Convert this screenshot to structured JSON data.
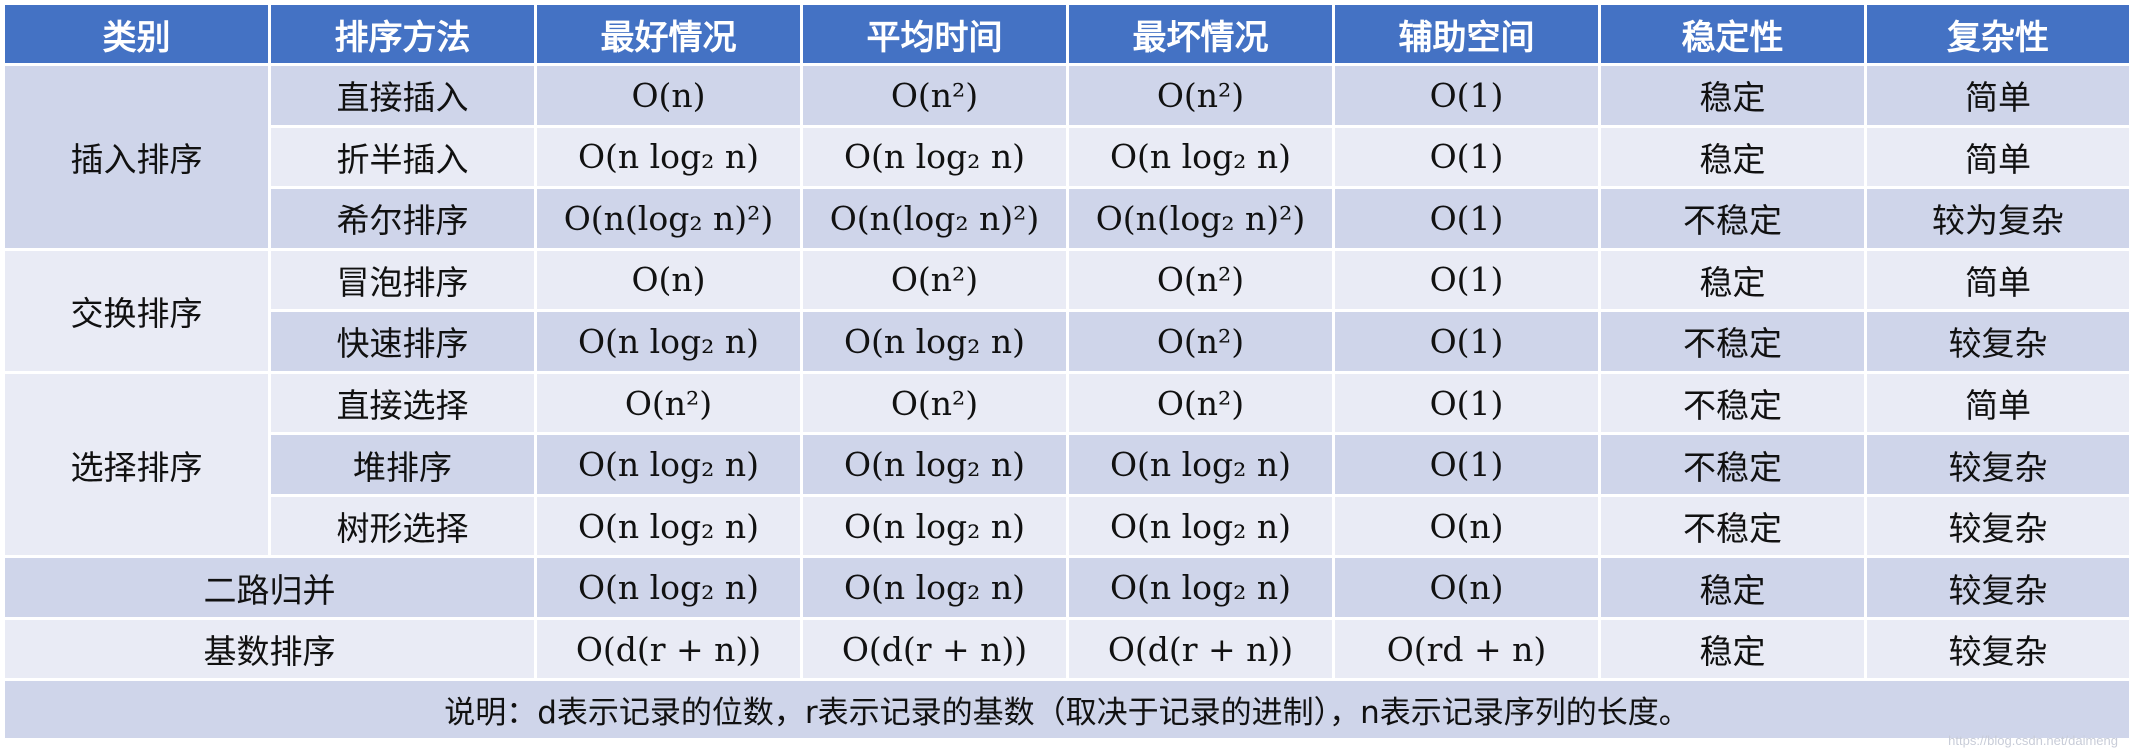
{
  "headers": [
    "类别",
    "排序方法",
    "最好情况",
    "平均时间",
    "最坏情况",
    "辅助空间",
    "稳定性",
    "复杂性"
  ],
  "groups": [
    {
      "category": "插入排序",
      "rows": [
        {
          "method": "直接插入",
          "best": "O(n)",
          "avg": "O(n²)",
          "worst": "O(n²)",
          "space": "O(1)",
          "stability": "稳定",
          "complexity": "简单"
        },
        {
          "method": "折半插入",
          "best": "O(n log₂ n)",
          "avg": "O(n log₂ n)",
          "worst": "O(n log₂ n)",
          "space": "O(1)",
          "stability": "稳定",
          "complexity": "简单"
        },
        {
          "method": "希尔排序",
          "best": "O(n(log₂ n)²)",
          "avg": "O(n(log₂ n)²)",
          "worst": "O(n(log₂ n)²)",
          "space": "O(1)",
          "stability": "不稳定",
          "complexity": "较为复杂"
        }
      ]
    },
    {
      "category": "交换排序",
      "rows": [
        {
          "method": "冒泡排序",
          "best": "O(n)",
          "avg": "O(n²)",
          "worst": "O(n²)",
          "space": "O(1)",
          "stability": "稳定",
          "complexity": "简单"
        },
        {
          "method": "快速排序",
          "best": "O(n log₂ n)",
          "avg": "O(n log₂ n)",
          "worst": "O(n²)",
          "space": "O(1)",
          "stability": "不稳定",
          "complexity": "较复杂"
        }
      ]
    },
    {
      "category": "选择排序",
      "rows": [
        {
          "method": "直接选择",
          "best": "O(n²)",
          "avg": "O(n²)",
          "worst": "O(n²)",
          "space": "O(1)",
          "stability": "不稳定",
          "complexity": "简单"
        },
        {
          "method": "堆排序",
          "best": "O(n log₂ n)",
          "avg": "O(n log₂ n)",
          "worst": "O(n log₂ n)",
          "space": "O(1)",
          "stability": "不稳定",
          "complexity": "较复杂"
        },
        {
          "method": "树形选择",
          "best": "O(n log₂ n)",
          "avg": "O(n log₂ n)",
          "worst": "O(n log₂ n)",
          "space": "O(n)",
          "stability": "不稳定",
          "complexity": "较复杂"
        }
      ]
    }
  ],
  "singles": [
    {
      "method": "二路归并",
      "best": "O(n log₂ n)",
      "avg": "O(n log₂ n)",
      "worst": "O(n log₂ n)",
      "space": "O(n)",
      "stability": "稳定",
      "complexity": "较复杂"
    },
    {
      "method": "基数排序",
      "best": "O(d(r + n))",
      "avg": "O(d(r + n))",
      "worst": "O(d(r + n))",
      "space": "O(rd + n)",
      "stability": "稳定",
      "complexity": "较复杂"
    }
  ],
  "note": "说明：d表示记录的位数，r表示记录的基数（取决于记录的进制），n表示记录序列的长度。",
  "watermark": "https://blog.csdn.net/daimeng",
  "colors": {
    "header": "#4472c4",
    "band_dark": "#cfd5ea",
    "band_light": "#e9ebf5",
    "border": "#ffffff"
  }
}
